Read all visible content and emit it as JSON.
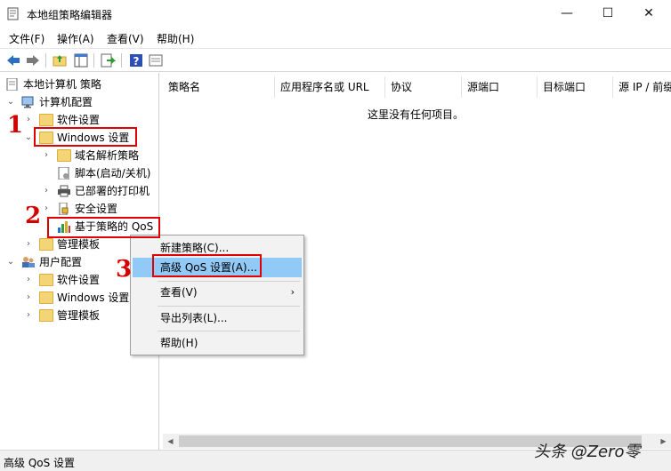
{
  "window": {
    "title": "本地组策略编辑器",
    "minimize": "—",
    "maximize": "☐",
    "close": "✕"
  },
  "menubar": [
    "文件(F)",
    "操作(A)",
    "查看(V)",
    "帮助(H)"
  ],
  "toolbar": {
    "icons": [
      "back-icon",
      "forward-icon",
      "up-folder-icon",
      "show-hide-tree-icon",
      "export-list-icon",
      "help-icon",
      "properties-icon"
    ]
  },
  "tree": {
    "root": "本地计算机 策略",
    "computer_config": "计算机配置",
    "software_settings": "软件设置",
    "windows_settings": "Windows 设置",
    "dns_policy": "域名解析策略",
    "scripts": "脚本(启动/关机)",
    "deployed_printers": "已部署的打印机",
    "security_settings": "安全设置",
    "qos": "基于策略的 QoS",
    "admin_templates": "管理模板",
    "user_config": "用户配置",
    "user_software_settings": "软件设置",
    "user_windows_settings": "Windows 设置",
    "user_admin_templates": "管理模板"
  },
  "list": {
    "columns": [
      "策略名",
      "应用程序名或 URL",
      "协议",
      "源端口",
      "目标端口",
      "源 IP / 前缀"
    ],
    "empty_message": "这里没有任何项目。"
  },
  "context_menu": {
    "new_policy": "新建策略(C)...",
    "advanced_qos": "高级 QoS 设置(A)...",
    "view": "查看(V)",
    "view_arrow": "›",
    "export_list": "导出列表(L)...",
    "help": "帮助(H)"
  },
  "callouts": [
    "1",
    "2",
    "3"
  ],
  "status": "高级 QoS 设置",
  "watermark": "头条 @Zero零"
}
